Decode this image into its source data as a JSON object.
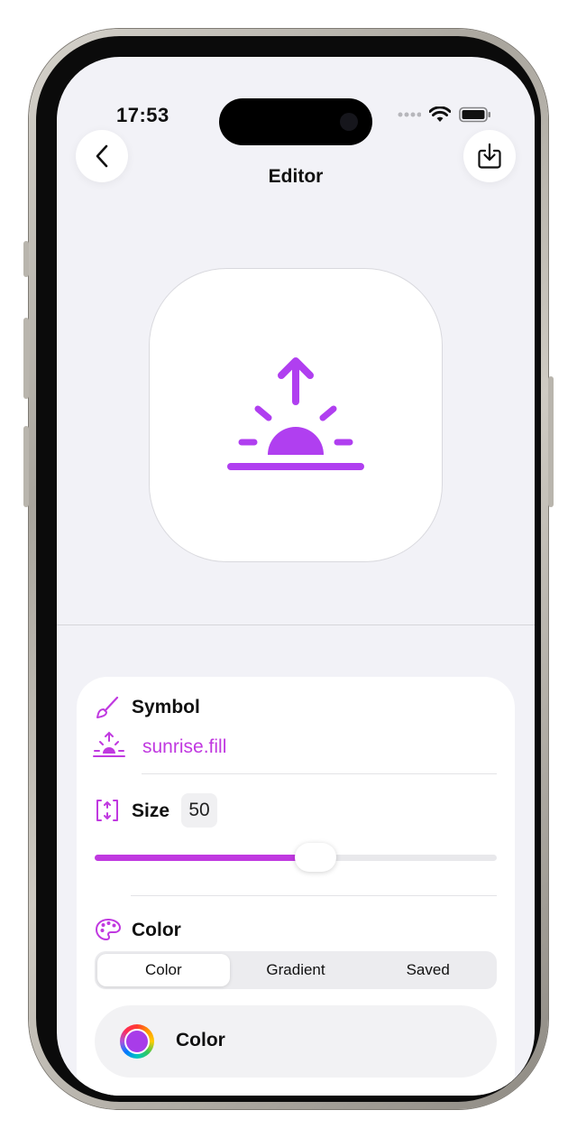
{
  "status": {
    "time": "17:53"
  },
  "nav": {
    "title": "Editor",
    "back_icon": "chevron-left-icon",
    "export_icon": "square-arrow-down-icon"
  },
  "theme": {
    "accent": "#c039e0",
    "symbol_color": "#b03ff0"
  },
  "preview": {
    "symbol_icon": "sunrise-fill-icon"
  },
  "symbol": {
    "label": "Symbol",
    "name": "sunrise.fill",
    "icon": "paintbrush-icon"
  },
  "size": {
    "label": "Size",
    "value": "50",
    "icon": "resize-icon",
    "slider_fraction": 0.55
  },
  "color": {
    "label": "Color",
    "icon": "palette-icon",
    "segments": [
      "Color",
      "Gradient",
      "Saved"
    ],
    "selected_segment": "Color",
    "picker_label": "Color",
    "swatch_color": "#a83ce9"
  }
}
